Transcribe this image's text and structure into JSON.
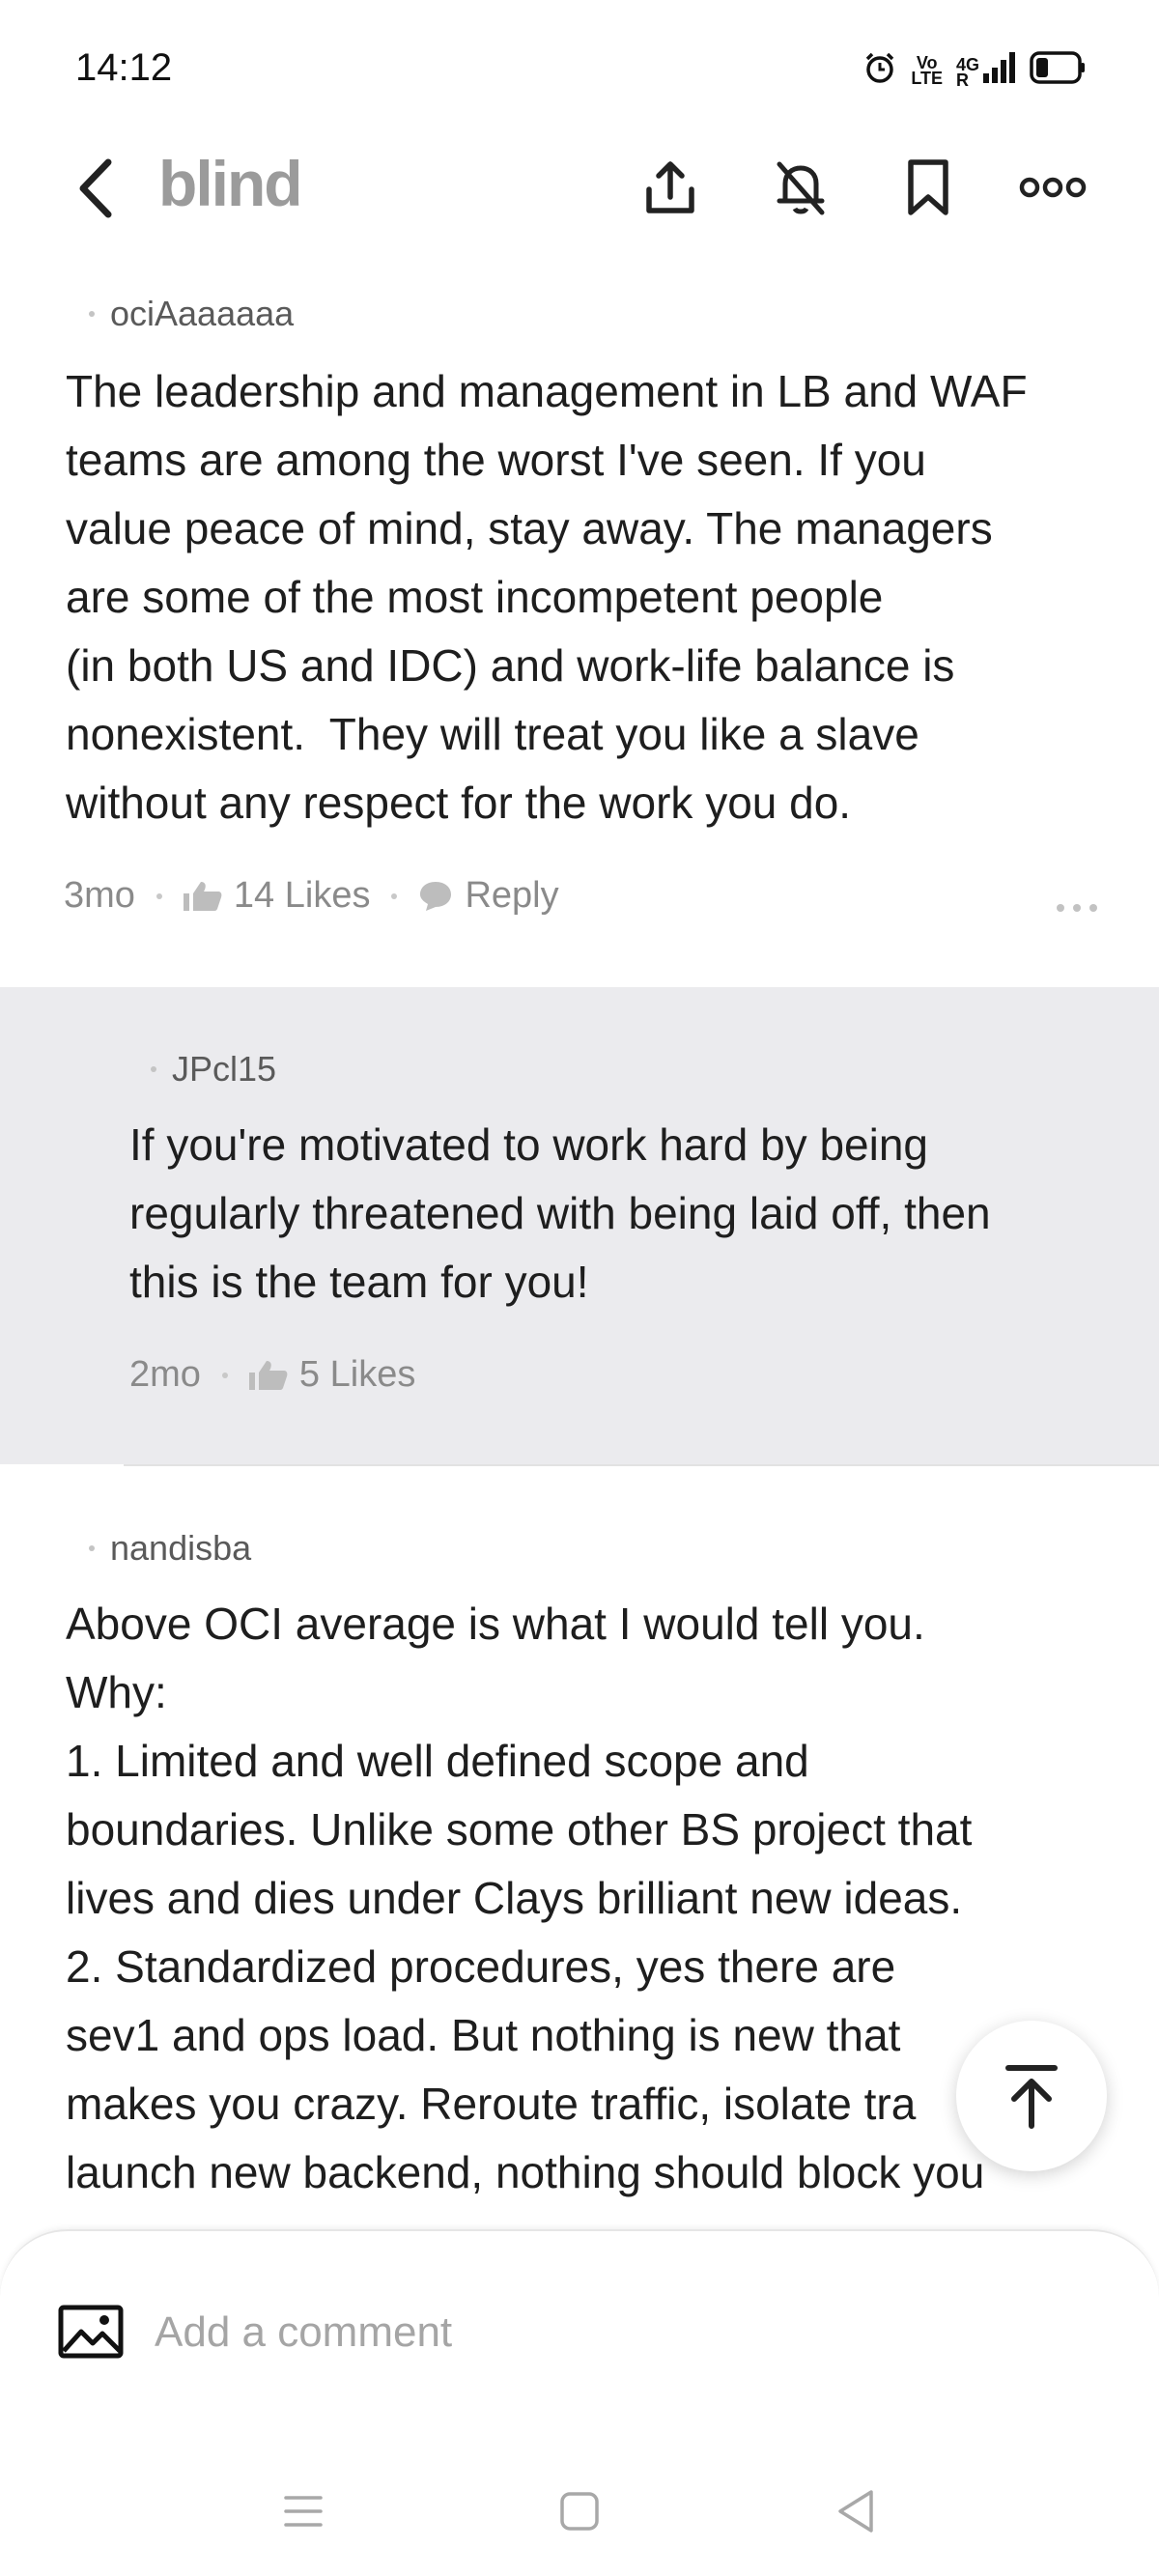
{
  "status_bar": {
    "time": "14:12",
    "network_label_top": "Vo",
    "network_label_bottom": "LTE",
    "network_type": "4G",
    "roaming": "R"
  },
  "header": {
    "app_name": "blind"
  },
  "comments": [
    {
      "author": "ociAaaaaaa",
      "text": "The leadership and management in LB and WAF\nteams are among the worst I've seen. If you\nvalue peace of mind, stay away. The managers\nare some of the most incompetent people\n(in both US and IDC) and work-life balance is\nnonexistent.  They will treat you like a slave\nwithout any respect for the work you do.",
      "age": "3mo",
      "likes": "14 Likes",
      "reply_label": "Reply"
    }
  ],
  "reply": {
    "author": "JPcl15",
    "text": "If you're motivated to work hard by being\nregularly threatened with being laid off, then\nthis is the team for you!",
    "age": "2mo",
    "likes": "5 Likes"
  },
  "comment2": {
    "author": "nandisba",
    "text": "Above OCI average is what I would tell you.\nWhy:\n1. Limited and well defined scope and\nboundaries. Unlike some other BS project that\nlives and dies under Clays brilliant new ideas.\n2. Standardized procedures, yes there are\nsev1 and ops load. But nothing is new that\nmakes you crazy. Reroute traffic, isolate tra\nlaunch new backend, nothing should block you"
  },
  "composer": {
    "placeholder": "Add a comment"
  },
  "icons": {
    "back": "chevron-left-icon",
    "share": "share-icon",
    "mute": "bell-off-icon",
    "bookmark": "bookmark-icon",
    "more": "more-horizontal-icon",
    "like": "thumbs-up-icon",
    "reply": "speech-bubble-icon",
    "scroll_top": "arrow-up-icon",
    "image": "image-icon"
  },
  "colors": {
    "brand_gray": "#9b9b9b",
    "reply_background": "#ebebee",
    "meta_text": "#8a8a8a"
  }
}
